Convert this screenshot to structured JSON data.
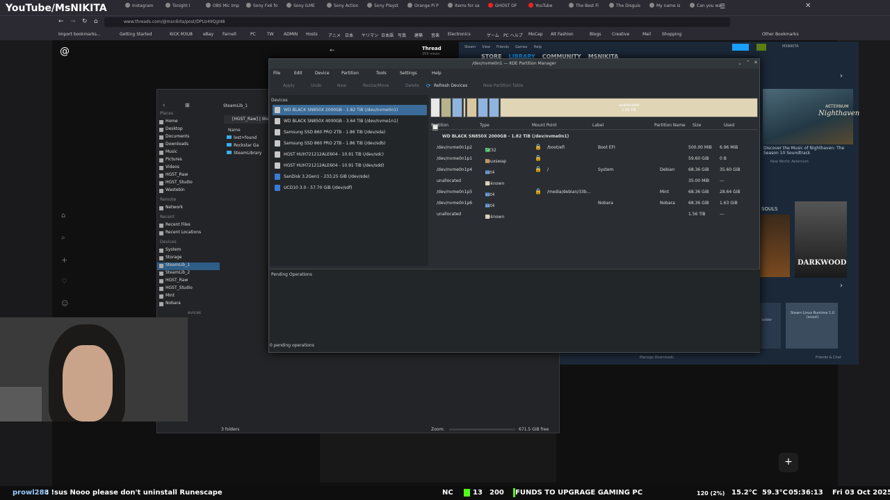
{
  "overlay": {
    "channel": "YouTube/MsNIKITA"
  },
  "browser": {
    "tabs": [
      "Instagram",
      "Tonight I",
      "OBS Mic Imp",
      "Sony Fx6 fo",
      "Sony ILME",
      "Sony Action",
      "Sony Playst",
      "Orange Pi P",
      "Items for sa",
      "GHOST OF",
      "YouTube",
      "The Best Fi",
      "The Disguis",
      "My name is",
      "Can you wa"
    ],
    "url": "www.threads.com/@msnikita/post/DPUz49Qgl48",
    "bookmarks": [
      "Import bookmarks...",
      "Getting Started",
      "KICK M3U8",
      "eBay",
      "Farnell",
      "PC",
      "TW",
      "ADMIN",
      "Hosts",
      "アニメ",
      "日本",
      "ヤリマン",
      "日本語",
      "写真",
      "建築",
      "音楽",
      "Electronics",
      "ゲーム",
      "PC ヘルプ",
      "MoCap",
      "Alt Fashion",
      "Blogs",
      "Creative",
      "Mail",
      "Shopping",
      "Other Bookmarks"
    ]
  },
  "threads": {
    "label": "Thread",
    "sub": "359 views"
  },
  "dolphin": {
    "breadcrumb": "SteamLib_1",
    "path_tab": "[HGST_Raw] | Wa",
    "col_name": "Name",
    "files": [
      "lost+found",
      "Rockstar Ga",
      "SteamLibrary"
    ],
    "places_header": "Places",
    "places": [
      "Home",
      "Desktop",
      "Documents",
      "Downloads",
      "Music",
      "Pictures",
      "Videos",
      "HGST_Raw",
      "HGST_Studio",
      "Wastebin"
    ],
    "remote_header": "Remote",
    "remote": [
      "Network"
    ],
    "recent_header": "Recent",
    "recent": [
      "Recent Files",
      "Recent Locations"
    ],
    "devices_header": "Devices",
    "devices": [
      "System",
      "Storage",
      "SteamLib_1",
      "SteamLib_2",
      "HGST_Raw",
      "HGST_Studio",
      "Mint",
      "Nobara"
    ],
    "extra": "evices",
    "status": "3 folders",
    "zoom": "Zoom:",
    "free": "671.5 GiB free"
  },
  "steam": {
    "menu": [
      "Steam",
      "View",
      "Friends",
      "Games",
      "Help"
    ],
    "nav": [
      "STORE",
      "LIBRARY",
      "COMMUNITY",
      "MSNIKITA"
    ],
    "user": "MSNIKITA",
    "game1": "Nighthaven",
    "game1_brand": "AETERNUM",
    "game1_desc": "Discover the Music of Nighthaven: The Season 10 Soundtrack",
    "game1_sub": "New World: Aeternum",
    "section": "SOULS",
    "game2": "DARKWOOD",
    "game3": "Steam Linux Runtime 1.0 (scout)",
    "game3b": "solder",
    "downloads": "Manage Downloads",
    "friends": "Friends & Chat"
  },
  "pm": {
    "title": "/dev/nvme0n1 — KDE Partition Manager",
    "menu": [
      "File",
      "Edit",
      "Device",
      "Partition",
      "Tools",
      "Settings",
      "Help"
    ],
    "toolbar": {
      "apply": "Apply",
      "undo": "Undo",
      "new": "New",
      "resize": "Resize/Move",
      "delete": "Delete",
      "refresh": "Refresh Devices",
      "new_table": "New Partition Table"
    },
    "devices_title": "Devices",
    "devices": [
      "WD BLACK SN850X 2000GB - 1.82 TiB (/dev/nvme0n1)",
      "WD BLACK SN850X 4000GB - 3.64 TiB (/dev/nvme1n1)",
      "Samsung SSD 860 PRO 2TB - 1.86 TiB (/dev/sda)",
      "Samsung SSD 860 PRO 2TB - 1.86 TiB (/dev/sdb)",
      "HGST HUH721212ALE604 - 10.91 TiB (/dev/sdc)",
      "HGST HUH721212ALE604 - 10.91 TiB (/dev/sdd)",
      "SanDisk 3.2Gen1 - 233.25 GiB (/dev/sde)",
      "UCD10 3.0 - 57.70 GiB (/dev/sdf)"
    ],
    "unalloc_map_label": "unallocated",
    "unalloc_map_size": "1.56 TiB",
    "headers": [
      "Partition",
      "Type",
      "Mount Point",
      "Label",
      "Partition Name",
      "Size",
      "Used"
    ],
    "disk_row": "WD BLACK SN850X 2000GB - 1.82 TiB (/dev/nvme0n1)",
    "rows": [
      {
        "part": "/dev/nvme0n1p2",
        "type": "fat32",
        "mount": "/boot/efi",
        "label": "Boot EFI",
        "pname": "",
        "size": "500.00 MiB",
        "used": "6.96 MiB",
        "lock": true,
        "color": "#22aa44"
      },
      {
        "part": "/dev/nvme0n1p1",
        "type": "linuxswap",
        "mount": "",
        "label": "",
        "pname": "",
        "size": "59.60 GiB",
        "used": "0 B",
        "lock": true,
        "color": "#b07a3a"
      },
      {
        "part": "/dev/nvme0n1p4",
        "type": "ext4",
        "mount": "/",
        "label": "System",
        "pname": "Debian",
        "size": "68.36 GiB",
        "used": "35.60 GiB",
        "lock": true,
        "color": "#3a6cb0"
      },
      {
        "part": "unallocated",
        "type": "unknown",
        "mount": "",
        "label": "",
        "pname": "",
        "size": "35.00 MiB",
        "used": "---",
        "lock": false,
        "color": "#d8cfae"
      },
      {
        "part": "/dev/nvme0n1p5",
        "type": "ext4",
        "mount": "/media/debian/33b...",
        "label": "",
        "pname": "Mint",
        "size": "68.36 GiB",
        "used": "28.64 GiB",
        "lock": true,
        "color": "#3a6cb0"
      },
      {
        "part": "/dev/nvme0n1p6",
        "type": "ext4",
        "mount": "",
        "label": "Nobara",
        "pname": "Nobara",
        "size": "68.36 GiB",
        "used": "1.63 GiB",
        "lock": false,
        "color": "#3a6cb0"
      },
      {
        "part": "unallocated",
        "type": "unknown",
        "mount": "",
        "label": "",
        "pname": "",
        "size": "1.56 TiB",
        "used": "---",
        "lock": false,
        "color": "#d8cfae"
      }
    ],
    "pending_title": "Pending Operations",
    "pending_status": "0 pending operations"
  },
  "statusbar": {
    "chat_user": "prowl288",
    "chat_msg": ": !sus Nooo please don't uninstall Runescape",
    "nc": "NC",
    "count1": "13",
    "count2": "200",
    "goal": "FUNDS TO UPGRAGE GAMING PC",
    "cpu": "120 (2%)",
    "temp": "15.2°C",
    "temp2": "59.3°C",
    "time": "05:36:13",
    "date": "Fri 03 Oct 2025"
  },
  "colors": {
    "accent": "#3b6c99",
    "fat32": "#22aa44",
    "ext4": "#3a6cb0",
    "swap": "#b07a3a",
    "unalloc": "#d8cfae"
  }
}
